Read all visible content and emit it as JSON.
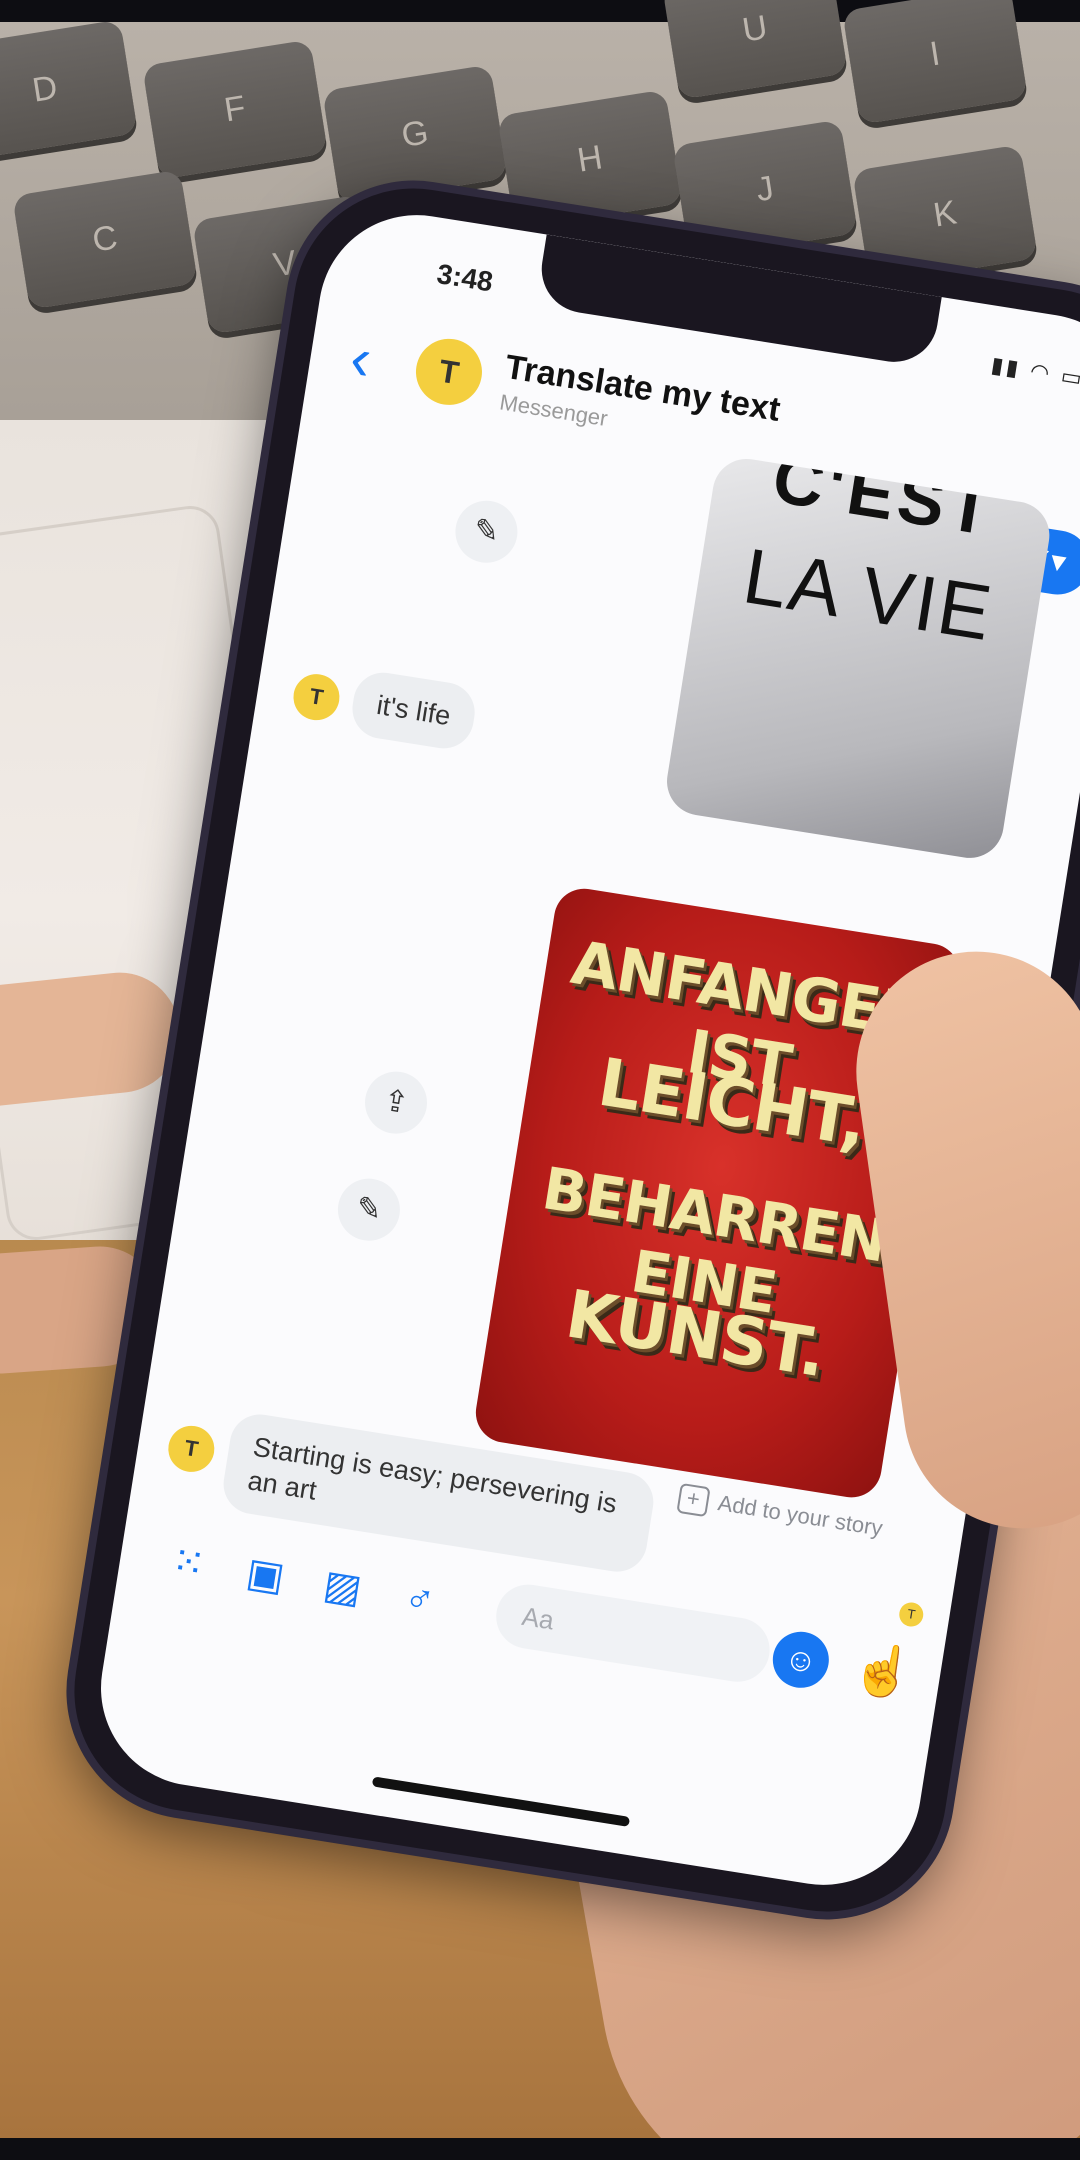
{
  "keyboard": {
    "keys": [
      "D",
      "F",
      "G",
      "H",
      "J",
      "K",
      "U",
      "I",
      "C",
      "V"
    ]
  },
  "status_bar": {
    "time": "3:48",
    "icons": "▮▮ ◠ ▭"
  },
  "header": {
    "back_icon": "‹",
    "avatar_letter": "T",
    "title": "Translate my text",
    "subtitle": "Messenger",
    "action_icon": "✔▾"
  },
  "messages": {
    "image_1_lines": [
      "C'EST",
      "LA VIE"
    ],
    "reply_1": "it's life",
    "reply_1_avatar": "T",
    "image_2_lines": [
      "ANFANGEN IST",
      "LEICHT,",
      "BEHARREN EINE",
      "KUNST."
    ],
    "reply_2": "Starting is easy; persevering is an art",
    "reply_2_avatar": "T",
    "edit_icon": "✎",
    "share_icon": "⇪",
    "add_to_story": "Add to your story",
    "add_to_story_icon": "+"
  },
  "composer": {
    "apps_icon": "⁙",
    "camera_icon": "▣",
    "gallery_icon": "▨",
    "mic_icon": "♂",
    "placeholder": "Aa",
    "emoji_icon": "☺",
    "like_icon": "☝",
    "seen_avatar": "T"
  },
  "colors": {
    "messenger_blue": "#1877f2",
    "avatar_yellow": "#f4cf3f",
    "poster_red": "#c8231f",
    "poster_text": "#f2e7a4"
  }
}
